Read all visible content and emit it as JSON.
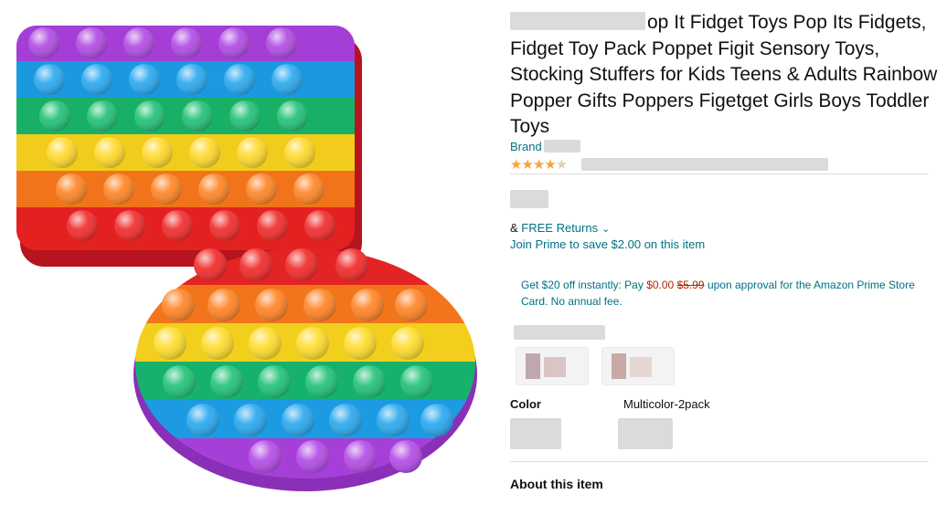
{
  "product": {
    "title_visible": "op It Fidget Toys Pop Its Fidgets, Fidget Toy Pack Poppet Figit Sensory Toys, Stocking Stuffers for Kids Teens & Adults Rainbow Popper Gifts Poppers Figetget Girls Boys Toddler Toys",
    "brand_label": "Brand",
    "stars_full": "★★★★",
    "stars_half": "★"
  },
  "delivery": {
    "ampersand": "& ",
    "free_returns": "FREE Returns",
    "chevron": "⌄",
    "prime_link": "Join Prime to save $2.00 on this item"
  },
  "promo": {
    "lead": "Get $20 off instantly: Pay ",
    "pay_amount": "$0.00",
    "old_price": "$5.99",
    "tail": " upon approval for the Amazon Prime Store Card. No annual fee."
  },
  "variation": {
    "color_label": "Color",
    "color_value": "Multicolor-2pack"
  },
  "about": {
    "heading": "About this item"
  },
  "colors": {
    "link": "#007185",
    "price_red": "#b12704",
    "star": "#f7a33b"
  }
}
